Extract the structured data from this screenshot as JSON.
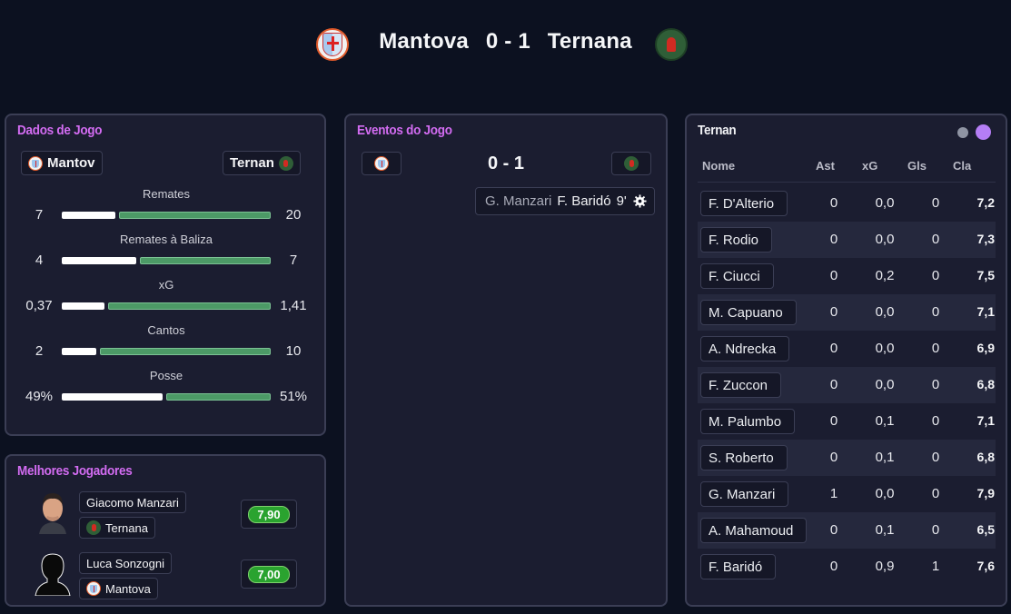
{
  "match": {
    "home": "Mantova",
    "away": "Ternana",
    "score": "0 - 1"
  },
  "match_data": {
    "title": "Dados de Jogo",
    "home_label": "Mantov",
    "away_label": "Ternan",
    "stats": [
      {
        "label": "Remates",
        "home": "7",
        "away": "20",
        "home_value": 7,
        "away_value": 20
      },
      {
        "label": "Remates à Baliza",
        "home": "4",
        "away": "7",
        "home_value": 4,
        "away_value": 7
      },
      {
        "label": "xG",
        "home": "0,37",
        "away": "1,41",
        "home_value": 0.37,
        "away_value": 1.41
      },
      {
        "label": "Cantos",
        "home": "2",
        "away": "10",
        "home_value": 2,
        "away_value": 10
      },
      {
        "label": "Posse",
        "home": "49%",
        "away": "51%",
        "home_value": 49,
        "away_value": 51
      }
    ]
  },
  "best_players": {
    "title": "Melhores Jogadores",
    "players": [
      {
        "name": "Giacomo Manzari",
        "team": "Ternana",
        "rating": "7,90"
      },
      {
        "name": "Luca Sonzogni",
        "team": "Mantova",
        "rating": "7,00"
      }
    ]
  },
  "events": {
    "title": "Eventos do Jogo",
    "score": "0 - 1",
    "items": [
      {
        "player_out": "G. Manzari",
        "player_in": "F. Baridó",
        "minute": "9'"
      }
    ]
  },
  "lineup": {
    "title": "Ternan",
    "columns": [
      "Nome",
      "Ast",
      "xG",
      "Gls",
      "Cla"
    ],
    "rows": [
      {
        "name": "F. D'Alterio",
        "ast": "0",
        "xg": "0,0",
        "gls": "0",
        "cla": "7,2"
      },
      {
        "name": "F. Rodio",
        "ast": "0",
        "xg": "0,0",
        "gls": "0",
        "cla": "7,3"
      },
      {
        "name": "F. Ciucci",
        "ast": "0",
        "xg": "0,2",
        "gls": "0",
        "cla": "7,5"
      },
      {
        "name": "M. Capuano",
        "ast": "0",
        "xg": "0,0",
        "gls": "0",
        "cla": "7,1"
      },
      {
        "name": "A. Ndrecka",
        "ast": "0",
        "xg": "0,0",
        "gls": "0",
        "cla": "6,9"
      },
      {
        "name": "F. Zuccon",
        "ast": "0",
        "xg": "0,0",
        "gls": "0",
        "cla": "6,8"
      },
      {
        "name": "M. Palumbo",
        "ast": "0",
        "xg": "0,1",
        "gls": "0",
        "cla": "7,1"
      },
      {
        "name": "S. Roberto",
        "ast": "0",
        "xg": "0,1",
        "gls": "0",
        "cla": "6,8"
      },
      {
        "name": "G. Manzari",
        "ast": "1",
        "xg": "0,0",
        "gls": "0",
        "cla": "7,9"
      },
      {
        "name": "A. Mahamoud",
        "ast": "0",
        "xg": "0,1",
        "gls": "0",
        "cla": "6,5"
      },
      {
        "name": "F. Baridó",
        "ast": "0",
        "xg": "0,9",
        "gls": "1",
        "cla": "7,6"
      }
    ]
  },
  "colors": {
    "accent_title": "#d36cf2",
    "away_bar": "#4c9a66",
    "home_bar": "#ffffff",
    "rating_badge": "#2aa32f",
    "toggle_active": "#b57ef5",
    "toggle_inactive": "#8f94a3"
  },
  "icons": [
    "mantova-crest-icon",
    "ternana-crest-icon",
    "gear-icon"
  ]
}
